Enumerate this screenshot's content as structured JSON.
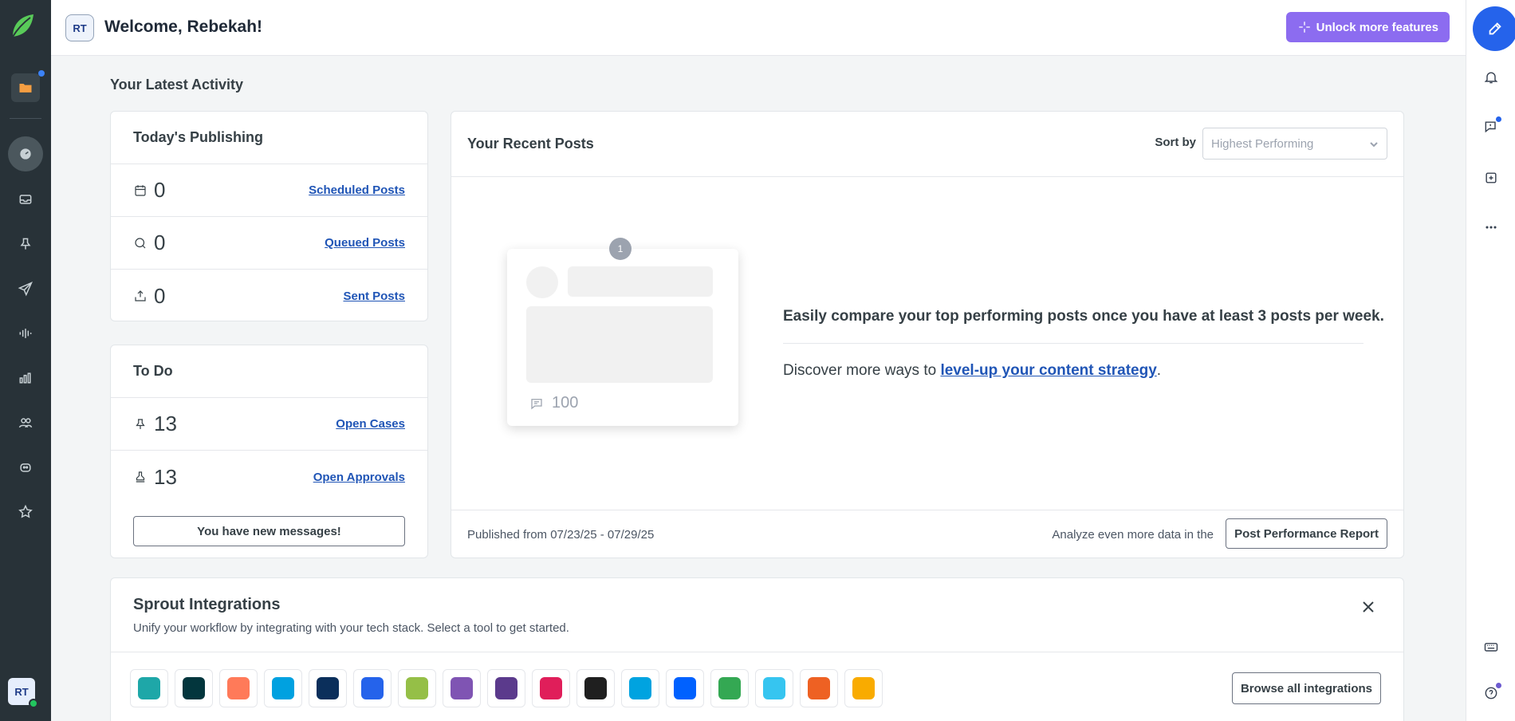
{
  "header": {
    "avatar_initials": "RT",
    "welcome": "Welcome, Rebekah!",
    "unlock_label": "Unlock more features"
  },
  "section_title": "Your Latest Activity",
  "publishing": {
    "title": "Today's Publishing",
    "rows": [
      {
        "count": "0",
        "link": "Scheduled Posts",
        "icon": "calendar-icon"
      },
      {
        "count": "0",
        "link": "Queued Posts",
        "icon": "queue-icon"
      },
      {
        "count": "0",
        "link": "Sent Posts",
        "icon": "sent-tray-icon"
      }
    ]
  },
  "todo": {
    "title": "To Do",
    "rows": [
      {
        "count": "13",
        "link": "Open Cases",
        "icon": "pin-icon"
      },
      {
        "count": "13",
        "link": "Open Approvals",
        "icon": "stamp-icon"
      }
    ],
    "messages_button": "You have new messages!"
  },
  "recent_posts": {
    "title": "Your Recent Posts",
    "sort_label": "Sort by",
    "sort_value": "Highest Performing",
    "badge": "1",
    "comment_count": "100",
    "compare_text": "Easily compare your top performing posts once you have at least 3 posts per week.",
    "discover_prefix": "Discover more ways to ",
    "discover_link": "level-up your content strategy",
    "discover_suffix": ".",
    "published_range": "Published from 07/23/25 - 07/29/25",
    "analyze_text": "Analyze even more data in the",
    "report_button": "Post Performance Report"
  },
  "integrations": {
    "title": "Sprout Integrations",
    "subtitle": "Unify your workflow by integrating with your tech stack. Select a tool to get started.",
    "browse_button": "Browse all integrations",
    "tools": [
      {
        "name": "workflow-icon",
        "color": "#1ea7a8"
      },
      {
        "name": "zendesk-icon",
        "color": "#03363d"
      },
      {
        "name": "hubspot-icon",
        "color": "#ff7a59"
      },
      {
        "name": "salesforce-icon",
        "color": "#00a1e0"
      },
      {
        "name": "dynamics-icon",
        "color": "#0b2f5b"
      },
      {
        "name": "shopping-bag-icon",
        "color": "#2563eb"
      },
      {
        "name": "shopify-icon",
        "color": "#95bf47"
      },
      {
        "name": "woocommerce-icon",
        "color": "#7f54b3"
      },
      {
        "name": "bars-icon",
        "color": "#5b3a8c"
      },
      {
        "name": "slack-grid-icon",
        "color": "#e01e5a"
      },
      {
        "name": "canva-icon",
        "color": "#1f1f1f"
      },
      {
        "name": "link-icon",
        "color": "#00a3e0"
      },
      {
        "name": "dropbox-icon",
        "color": "#0061ff"
      },
      {
        "name": "google-drive-icon",
        "color": "#34a853"
      },
      {
        "name": "slack-icon",
        "color": "#36c5f0"
      },
      {
        "name": "bitly-icon",
        "color": "#ee6123"
      },
      {
        "name": "analytics-icon",
        "color": "#f9ab00"
      }
    ]
  },
  "nav": {
    "avatar_initials": "RT"
  }
}
